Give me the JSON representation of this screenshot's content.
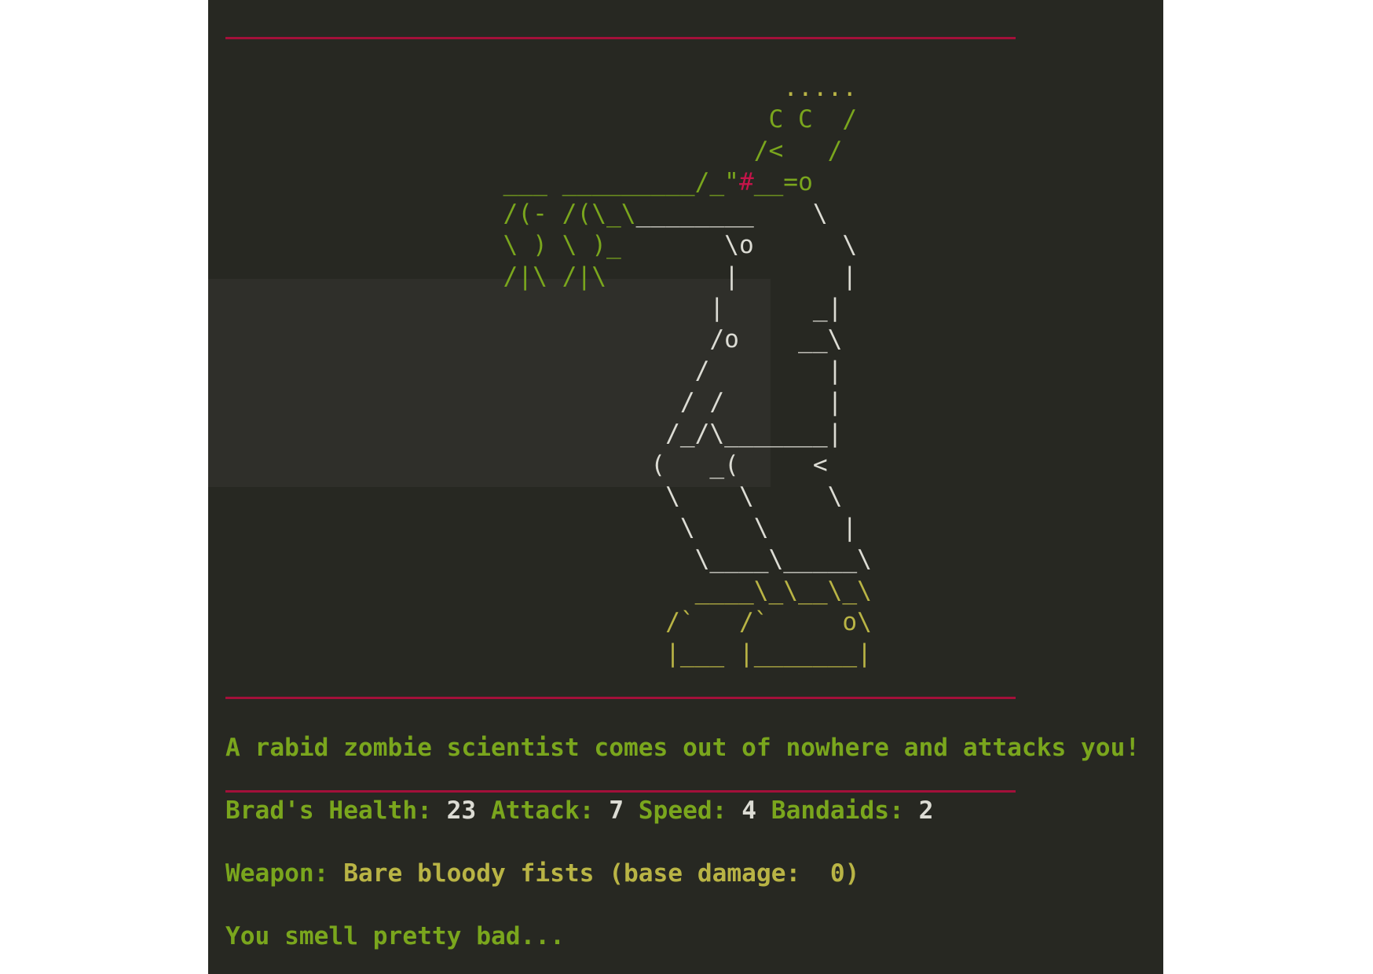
{
  "colors": {
    "background": "#272822",
    "green": "#7aa61d",
    "white": "#dcdcd4",
    "yellow": "#b9b445",
    "red": "#c5144a"
  },
  "art": [
    [
      [
        "                                       .....",
        "y"
      ]
    ],
    [
      [
        "                                      C C  /",
        "g"
      ]
    ],
    [
      [
        "                                     /<   /",
        "g"
      ]
    ],
    [
      [
        "                    ___ _________/_\"",
        "g"
      ],
      [
        "#",
        "r"
      ],
      [
        "__=o",
        "g"
      ]
    ],
    [
      [
        "                    /(- /(\\_\\",
        "g"
      ],
      [
        "________    \\",
        "w"
      ]
    ],
    [
      [
        "                    \\ ) \\ )_",
        "g"
      ],
      [
        "       \\o      \\",
        "w"
      ]
    ],
    [
      [
        "                    /|\\ /|\\",
        "g"
      ],
      [
        "        |       |",
        "w"
      ]
    ],
    [
      [
        "                                  |      _|",
        "w"
      ]
    ],
    [
      [
        "                                  /o    __\\",
        "w"
      ]
    ],
    [
      [
        "                                 /        |",
        "w"
      ]
    ],
    [
      [
        "                                / /       |",
        "w"
      ]
    ],
    [
      [
        "                               /_/\\_______|",
        "w"
      ]
    ],
    [
      [
        "                              (   _(     <",
        "w"
      ]
    ],
    [
      [
        "                               \\    \\     \\",
        "w"
      ]
    ],
    [
      [
        "                                \\    \\     |",
        "w"
      ]
    ],
    [
      [
        "                                 \\____\\_____\\",
        "w"
      ]
    ],
    [
      [
        "                                 ____\\_\\__\\_\\",
        "y"
      ]
    ],
    [
      [
        "                               /`   /`     o\\",
        "y"
      ]
    ],
    [
      [
        "                               |___ |_______|",
        "y"
      ]
    ]
  ],
  "message": "A rabid zombie scientist comes out of nowhere and attacks you!",
  "stats": {
    "health_label": "Brad's Health:",
    "health": "23",
    "attack_label": "Attack:",
    "attack": "7",
    "speed_label": "Speed:",
    "speed": "4",
    "bandaids_label": "Bandaids:",
    "bandaids": "2"
  },
  "weapon": {
    "label": "Weapon:",
    "value": "Bare bloody fists (base damage:  0)"
  },
  "status": "You smell pretty bad..."
}
